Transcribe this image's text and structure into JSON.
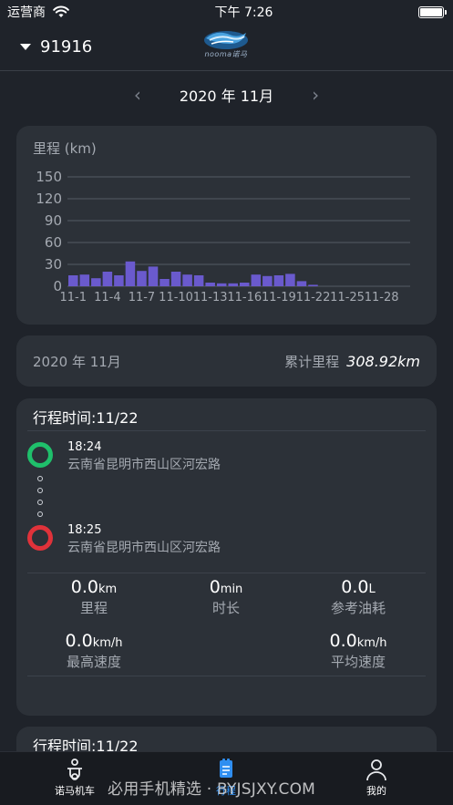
{
  "status_bar": {
    "carrier": "运营商",
    "time": "下午 7:26",
    "battery_level": 1.0
  },
  "header": {
    "vehicle_id": "91916",
    "logo_text": "nooma诺马"
  },
  "month_nav": {
    "label": "2020 年 11月"
  },
  "chart_data": {
    "type": "bar",
    "title": "里程 (km)",
    "categories": [
      "11-1",
      "11-2",
      "11-3",
      "11-4",
      "11-5",
      "11-6",
      "11-7",
      "11-8",
      "11-9",
      "11-10",
      "11-11",
      "11-12",
      "11-13",
      "11-14",
      "11-15",
      "11-16",
      "11-17",
      "11-18",
      "11-19",
      "11-20",
      "11-21",
      "11-22",
      "11-23",
      "11-24",
      "11-25",
      "11-26",
      "11-27",
      "11-28",
      "11-29",
      "11-30"
    ],
    "tick_labels": [
      "11-1",
      "11-4",
      "11-7",
      "11-10",
      "11-13",
      "11-16",
      "11-19",
      "11-22",
      "11-25",
      "11-28"
    ],
    "values": [
      15,
      16,
      11,
      20,
      15,
      34,
      21,
      27,
      10,
      20,
      16,
      15,
      5,
      4,
      4,
      5,
      16,
      14,
      15,
      17,
      7,
      2,
      0,
      0,
      0,
      0,
      0,
      0,
      0,
      0
    ],
    "yticks": [
      0,
      30,
      60,
      90,
      120,
      150
    ],
    "ylim": [
      0,
      150
    ],
    "bar_color": "#6a5acd",
    "grid_color": "#555b63"
  },
  "summary": {
    "month": "2020 年 11月",
    "total_label": "累计里程",
    "total_value": "308.92km"
  },
  "trip": {
    "title": "行程时间:11/22",
    "start": {
      "time": "18:24",
      "address": "云南省昆明市西山区河宏路",
      "color": "#1fbf6b"
    },
    "end": {
      "time": "18:25",
      "address": "云南省昆明市西山区河宏路",
      "color": "#e0323a"
    },
    "stats": {
      "distance": {
        "value": "0.0",
        "unit": "km",
        "label": "里程"
      },
      "duration": {
        "value": "0",
        "unit": "min",
        "label": "时长"
      },
      "fuel": {
        "value": "0.0",
        "unit": "L",
        "label": "参考油耗"
      },
      "max_speed": {
        "value": "0.0",
        "unit": "km/h",
        "label": "最高速度"
      },
      "avg_speed": {
        "value": "0.0",
        "unit": "km/h",
        "label": "平均速度"
      }
    }
  },
  "trip2": {
    "title": "行程时间:11/22"
  },
  "tab_bar": {
    "tabs": [
      {
        "label": "诺马机车",
        "icon": "scooter-icon",
        "active": false
      },
      {
        "label": "行程",
        "icon": "trip-document-icon",
        "active": true
      },
      {
        "label": "我的",
        "icon": "person-icon",
        "active": false
      }
    ],
    "active_color": "#2f8ef0",
    "watermark": "必用手机精选 · BYJSJXY.COM"
  }
}
